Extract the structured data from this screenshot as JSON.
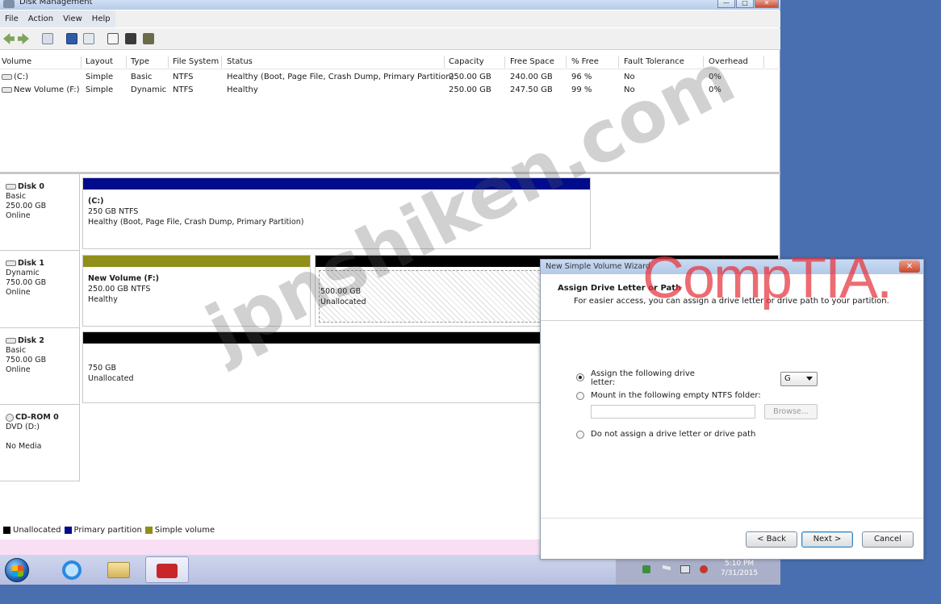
{
  "window": {
    "title": "Disk Management",
    "controls": [
      "—",
      "□",
      "✕"
    ]
  },
  "menubar": [
    "File",
    "Action",
    "View",
    "Help"
  ],
  "volume_list": {
    "columns": [
      "Volume",
      "Layout",
      "Type",
      "File System",
      "Status",
      "Capacity",
      "Free Space",
      "% Free",
      "Fault Tolerance",
      "Overhead"
    ],
    "rows": [
      [
        "(C:)",
        "Simple",
        "Basic",
        "NTFS",
        "Healthy (Boot, Page File, Crash Dump, Primary Partition)",
        "250.00 GB",
        "240.00 GB",
        "96 %",
        "No",
        "0%"
      ],
      [
        "New Volume (F:)",
        "Simple",
        "Dynamic",
        "NTFS",
        "Healthy",
        "250.00 GB",
        "247.50 GB",
        "99 %",
        "No",
        "0%"
      ]
    ]
  },
  "disks": [
    {
      "name": "Disk 0",
      "type": "Basic",
      "size": "250.00 GB",
      "status": "Online",
      "partitions": [
        {
          "title": "(C:)",
          "line1": "250 GB NTFS",
          "line2": "Healthy (Boot, Page File, Crash Dump, Primary Partition)",
          "bar_color": "#000c8c"
        }
      ]
    },
    {
      "name": "Disk 1",
      "type": "Dynamic",
      "size": "750.00 GB",
      "status": "Online",
      "partitions": [
        {
          "title": "New Volume (F:)",
          "line1": "250.00 GB NTFS",
          "line2": "Healthy",
          "bar_color": "#8f8f1a"
        },
        {
          "title": "",
          "line1": "500.00 GB",
          "line2": "Unallocated",
          "bar_color": "#000000"
        }
      ]
    },
    {
      "name": "Disk 2",
      "type": "Basic",
      "size": "750.00 GB",
      "status": "Online",
      "partitions": [
        {
          "title": "",
          "line1": "750 GB",
          "line2": "Unallocated",
          "bar_color": "#000000"
        }
      ]
    },
    {
      "name": "CD-ROM 0",
      "type": "DVD (D:)",
      "size": "",
      "status": "No Media",
      "partitions": []
    }
  ],
  "legend": [
    {
      "label": "Unallocated",
      "color": "#000000"
    },
    {
      "label": "Primary partition",
      "color": "#000c8c"
    },
    {
      "label": "Simple volume",
      "color": "#8f8f1a"
    }
  ],
  "wizard": {
    "title": "New Simple Volume Wizard",
    "close": "✕",
    "heading": "Assign Drive Letter or Path",
    "subheading": "For easier access, you can assign a drive letter or drive path to your partition.",
    "option_assign_line1": "Assign the following drive",
    "option_assign_line2": "letter:",
    "option_mount": "Mount in the following empty NTFS folder:",
    "option_none": "Do not assign a drive letter or drive path",
    "selected_letter": "G",
    "ntfs_path_value": "",
    "browse_label": "Browse...",
    "back_label": "< Back",
    "next_label": "Next >",
    "cancel_label": "Cancel"
  },
  "taskbar": {
    "time": "5:10 PM",
    "date": "7/31/2015"
  },
  "watermarks": {
    "site": "jpnshiken.com",
    "brand": "CompTIA."
  }
}
